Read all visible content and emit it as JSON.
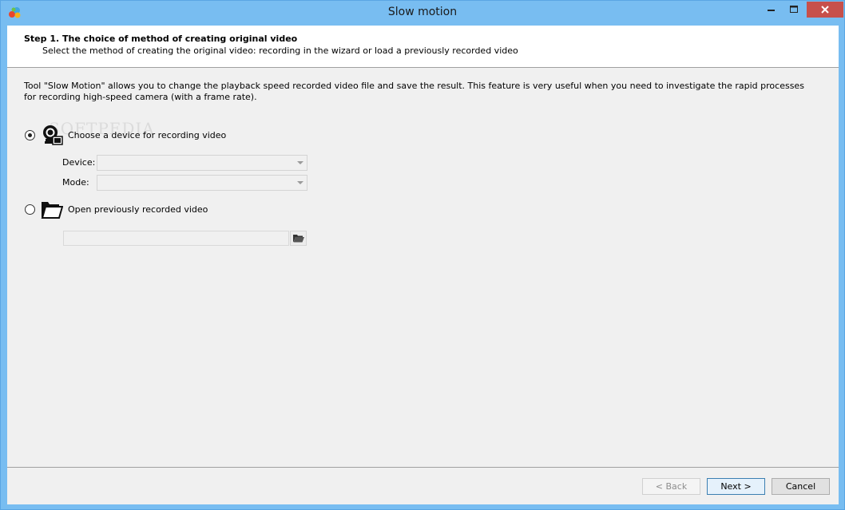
{
  "window": {
    "title": "Slow motion",
    "controls": {
      "minimize": "minimize",
      "maximize": "maximize",
      "close": "close"
    }
  },
  "header": {
    "step_title": "Step 1. The choice of method of creating original video",
    "step_subtitle": "Select the method of creating the original video: recording in the wizard or load a previously recorded video"
  },
  "description": "Tool \"Slow Motion\" allows you to change the playback speed recorded video file and save the result. This feature is very useful when you need to investigate the rapid processes for recording high-speed camera (with a frame rate).",
  "options": {
    "device": {
      "label": "Choose a device for recording video",
      "selected": true,
      "icon": "webcam-icon",
      "device_label": "Device:",
      "device_value": "",
      "mode_label": "Mode:",
      "mode_value": ""
    },
    "file": {
      "label": "Open previously recorded video",
      "selected": false,
      "icon": "folder-icon",
      "path_value": ""
    }
  },
  "watermark": "SOFTPEDIA",
  "buttons": {
    "back": "< Back",
    "next": "Next >",
    "cancel": "Cancel"
  }
}
